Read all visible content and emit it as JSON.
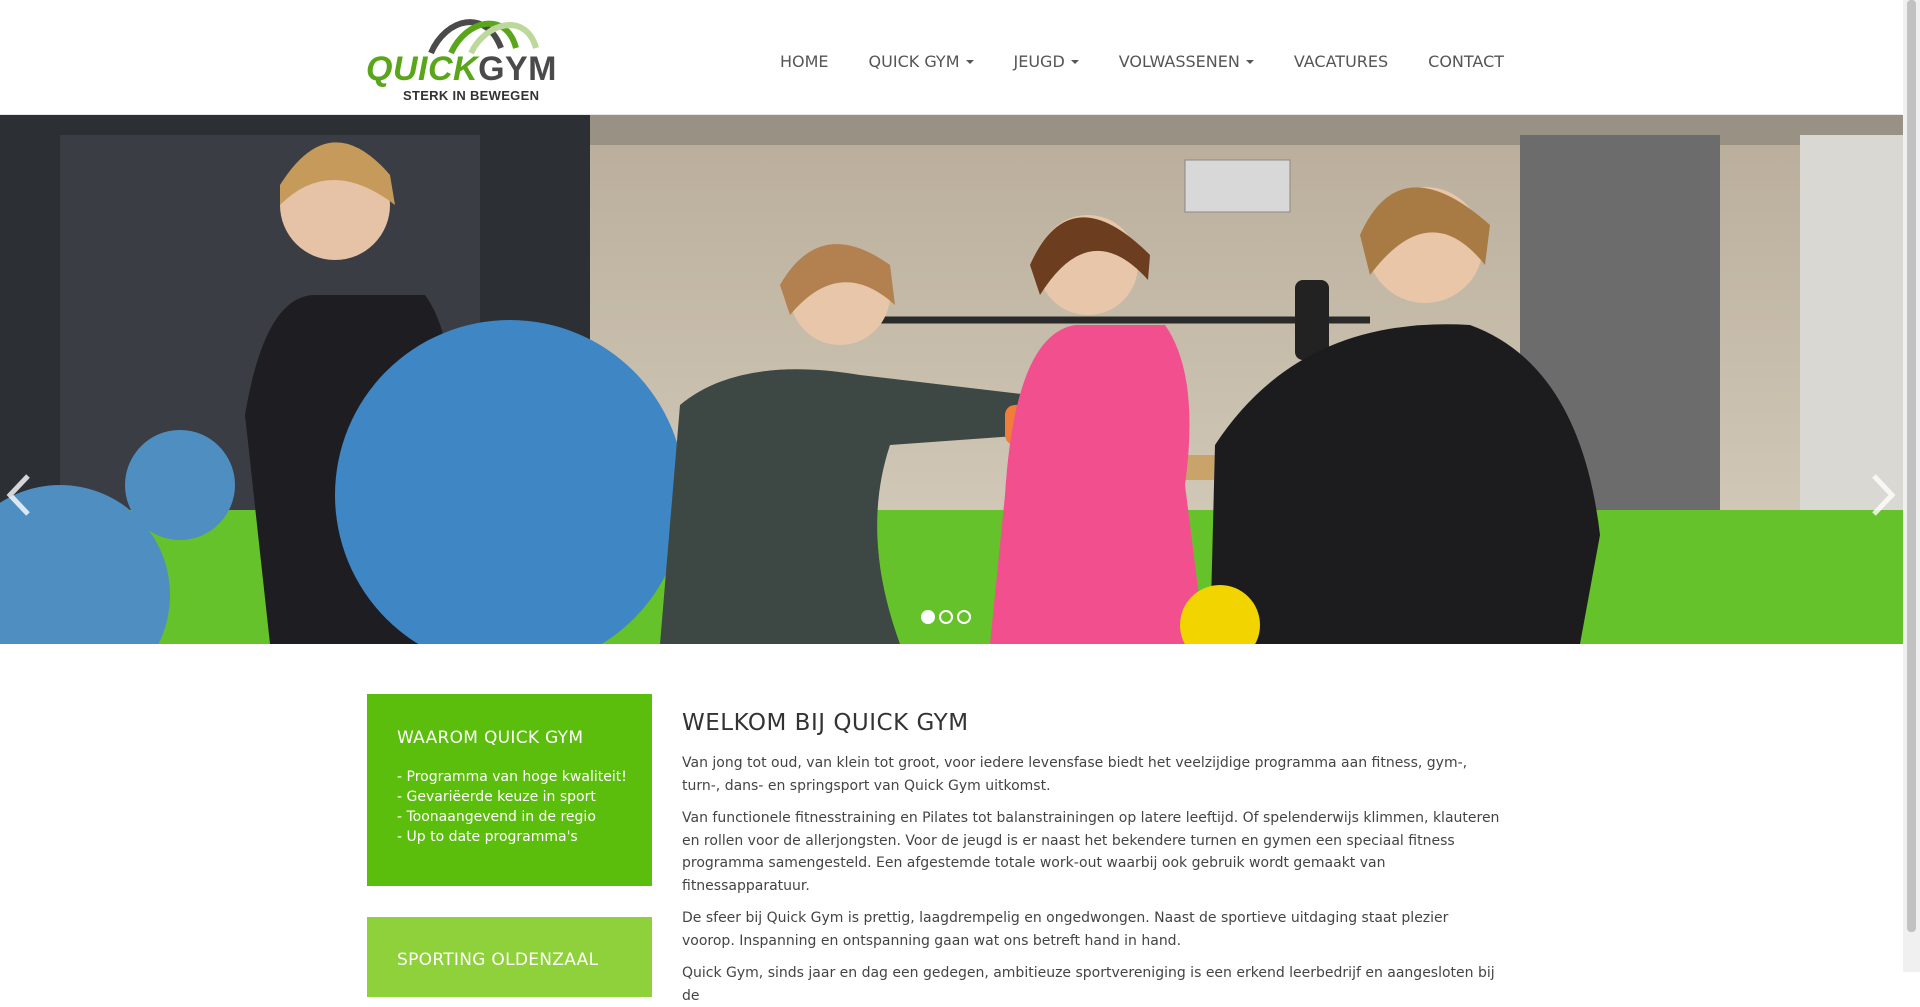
{
  "logo": {
    "brand_part1": "QUICK",
    "brand_part2": "GYM",
    "tagline": "STERK IN BEWEGEN"
  },
  "nav": [
    {
      "label": "HOME",
      "dropdown": false
    },
    {
      "label": "QUICK GYM",
      "dropdown": true
    },
    {
      "label": "JEUGD",
      "dropdown": true
    },
    {
      "label": "VOLWASSENEN",
      "dropdown": true
    },
    {
      "label": "VACATURES",
      "dropdown": false
    },
    {
      "label": "CONTACT",
      "dropdown": false
    }
  ],
  "carousel": {
    "slides": 3,
    "active_index": 0
  },
  "sidebar": {
    "box1": {
      "title": "WAAROM QUICK GYM",
      "items": [
        "- Programma van hoge kwaliteit!",
        "- Gevariëerde keuze in sport",
        "- Toonaangevend in de regio",
        "- Up to date programma's"
      ]
    },
    "box2": {
      "title": "SPORTING OLDENZAAL"
    }
  },
  "main": {
    "heading": "WELKOM BIJ QUICK GYM",
    "paragraphs": [
      "Van jong tot oud, van klein tot groot, voor iedere levensfase biedt het veelzijdige programma aan fitness, gym-, turn-, dans- en springsport van Quick Gym uitkomst.",
      "Van functionele fitnesstraining en Pilates tot balanstrainingen op latere leeftijd. Of spelenderwijs klimmen, klauteren en rollen voor de allerjongsten. Voor de jeugd is er naast het bekendere turnen en gymen een speciaal fitness programma samengesteld. Een afgestemde totale work-out waarbij ook gebruik wordt gemaakt van fitnessapparatuur.",
      "De sfeer bij Quick Gym is prettig, laagdrempelig en ongedwongen. Naast de sportieve uitdaging staat plezier voorop. Inspanning en ontspanning gaan wat ons betreft hand in hand.",
      "Quick Gym, sinds jaar en dag een gedegen, ambitieuze sportvereniging is een erkend leerbedrijf en aangesloten bij de"
    ]
  },
  "colors": {
    "brand_green": "#5cbe0c",
    "light_green": "#8fd13b",
    "dark_text": "#333333"
  }
}
